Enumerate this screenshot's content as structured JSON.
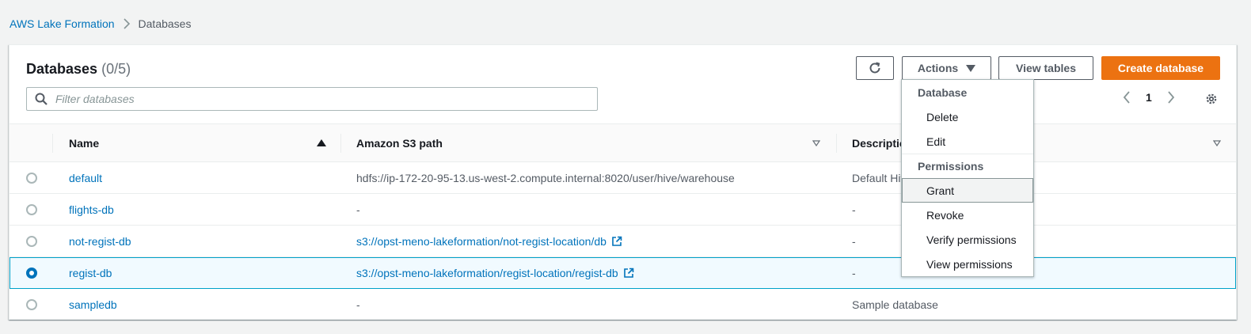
{
  "breadcrumb": {
    "root": "AWS Lake Formation",
    "current": "Databases"
  },
  "panel": {
    "title": "Databases",
    "count": "(0/5)",
    "filter_placeholder": "Filter databases"
  },
  "toolbar": {
    "actions_label": "Actions",
    "view_tables_label": "View tables",
    "create_label": "Create database",
    "page": "1"
  },
  "table": {
    "columns": {
      "name": "Name",
      "s3": "Amazon S3 path",
      "desc": "Description"
    },
    "rows": [
      {
        "name": "default",
        "s3": "hdfs://ip-172-20-95-13.us-west-2.compute.internal:8020/user/hive/warehouse",
        "desc": "Default Hive database",
        "s3_link": false,
        "selected": false
      },
      {
        "name": "flights-db",
        "s3": "-",
        "desc": "-",
        "s3_link": false,
        "selected": false
      },
      {
        "name": "not-regist-db",
        "s3": "s3://opst-meno-lakeformation/not-regist-location/db",
        "desc": "-",
        "s3_link": true,
        "selected": false
      },
      {
        "name": "regist-db",
        "s3": "s3://opst-meno-lakeformation/regist-location/regist-db",
        "desc": "-",
        "s3_link": true,
        "selected": true
      },
      {
        "name": "sampledb",
        "s3": "-",
        "desc": "Sample database",
        "s3_link": false,
        "selected": false
      }
    ]
  },
  "dropdown": {
    "group_database": "Database",
    "delete": "Delete",
    "edit": "Edit",
    "group_permissions": "Permissions",
    "grant": "Grant",
    "revoke": "Revoke",
    "verify": "Verify permissions",
    "view": "View permissions"
  },
  "colors": {
    "accent": "#0073bb",
    "primary_button": "#ec7211",
    "selected_row_bg": "#f1faff",
    "selected_row_border": "#00a1c9"
  },
  "icons": [
    "chevron-right-icon",
    "search-icon",
    "refresh-icon",
    "caret-down-icon",
    "chevron-left-icon",
    "settings-gear-icon",
    "sort-ascending-icon",
    "sort-icon",
    "external-link-icon"
  ]
}
